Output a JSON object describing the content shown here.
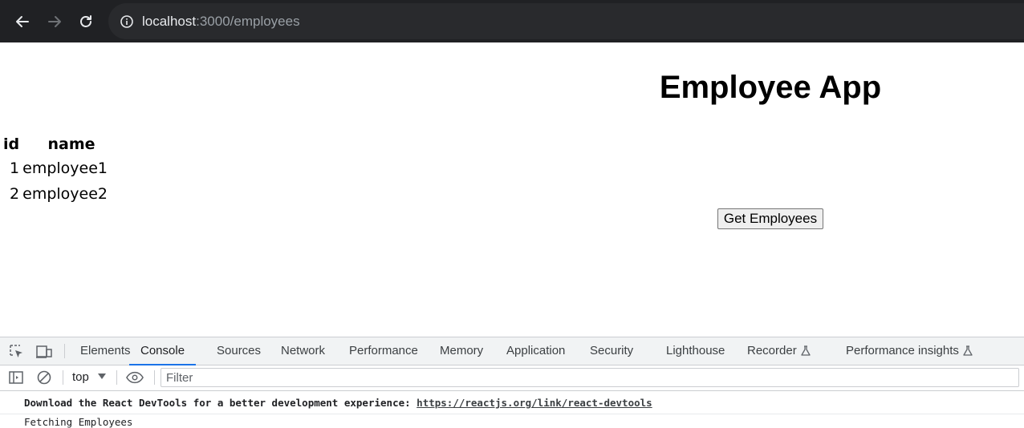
{
  "browser": {
    "url_host": "localhost",
    "url_path": ":3000/employees",
    "back_icon": "arrow-left-icon",
    "forward_icon": "arrow-right-icon",
    "reload_icon": "reload-icon",
    "info_icon": "info-icon"
  },
  "app": {
    "title": "Employee App",
    "table": {
      "headers": [
        "id",
        "name"
      ],
      "rows": [
        {
          "id": "1",
          "name": "employee1"
        },
        {
          "id": "2",
          "name": "employee2"
        }
      ]
    },
    "get_button_label": "Get Employees"
  },
  "devtools": {
    "tabs": [
      "Elements",
      "Console",
      "Sources",
      "Network",
      "Performance",
      "Memory",
      "Application",
      "Security",
      "Lighthouse",
      "Recorder",
      "Performance insights"
    ],
    "active_tab": "Console",
    "context": "top",
    "filter_placeholder": "Filter",
    "console_messages": [
      {
        "text": "Download the React DevTools for a better development experience: ",
        "link": "https://reactjs.org/link/react-devtools"
      },
      {
        "text": "Fetching Employees"
      }
    ],
    "accent_color": "#1a73e8"
  }
}
